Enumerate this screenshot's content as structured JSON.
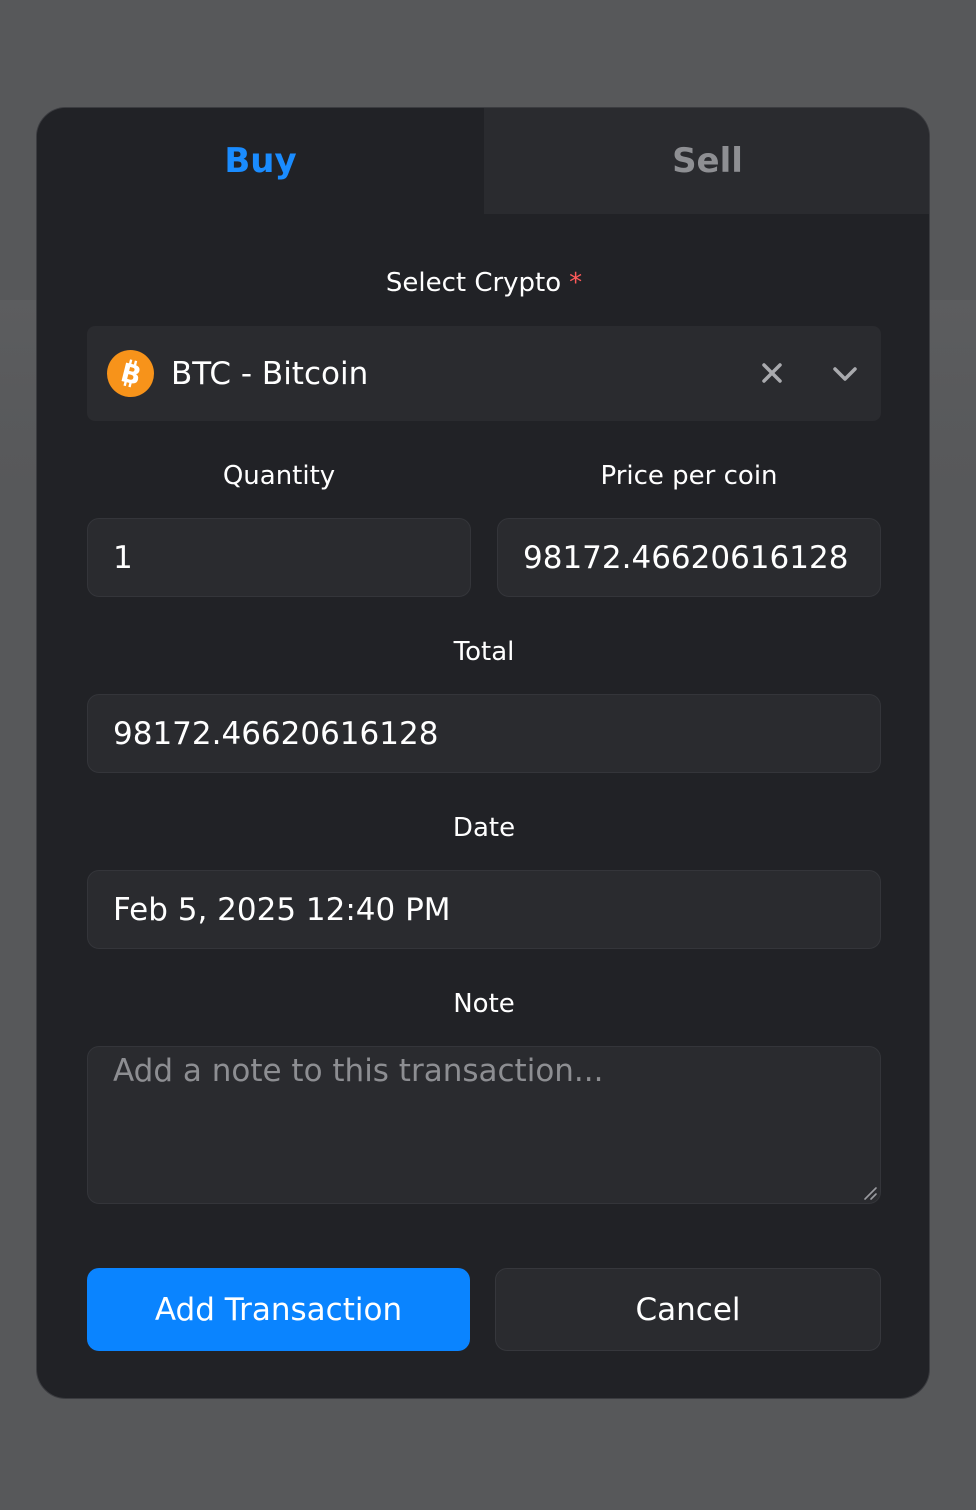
{
  "tabs": {
    "buy_label": "Buy",
    "sell_label": "Sell",
    "active": "Buy"
  },
  "form": {
    "crypto": {
      "label": "Select Crypto",
      "required_mark": "*",
      "selected_value": "BTC - Bitcoin",
      "icon": "bitcoin-icon",
      "clear_icon": "close-icon",
      "dropdown_icon": "chevron-down-icon"
    },
    "quantity": {
      "label": "Quantity",
      "value": "1"
    },
    "price": {
      "label": "Price per coin",
      "value": "98172.46620616128"
    },
    "total": {
      "label": "Total",
      "value": "98172.46620616128"
    },
    "date": {
      "label": "Date",
      "value": "Feb 5, 2025 12:40 PM"
    },
    "note": {
      "label": "Note",
      "placeholder": "Add a note to this transaction..."
    }
  },
  "actions": {
    "add_label": "Add Transaction",
    "cancel_label": "Cancel"
  },
  "colors": {
    "accent": "#0a84ff",
    "tab_active": "#1a8cff",
    "bitcoin": "#f7931a",
    "required": "#ff5a5a",
    "modal_bg": "#212226",
    "field_bg": "#2a2b2f"
  }
}
